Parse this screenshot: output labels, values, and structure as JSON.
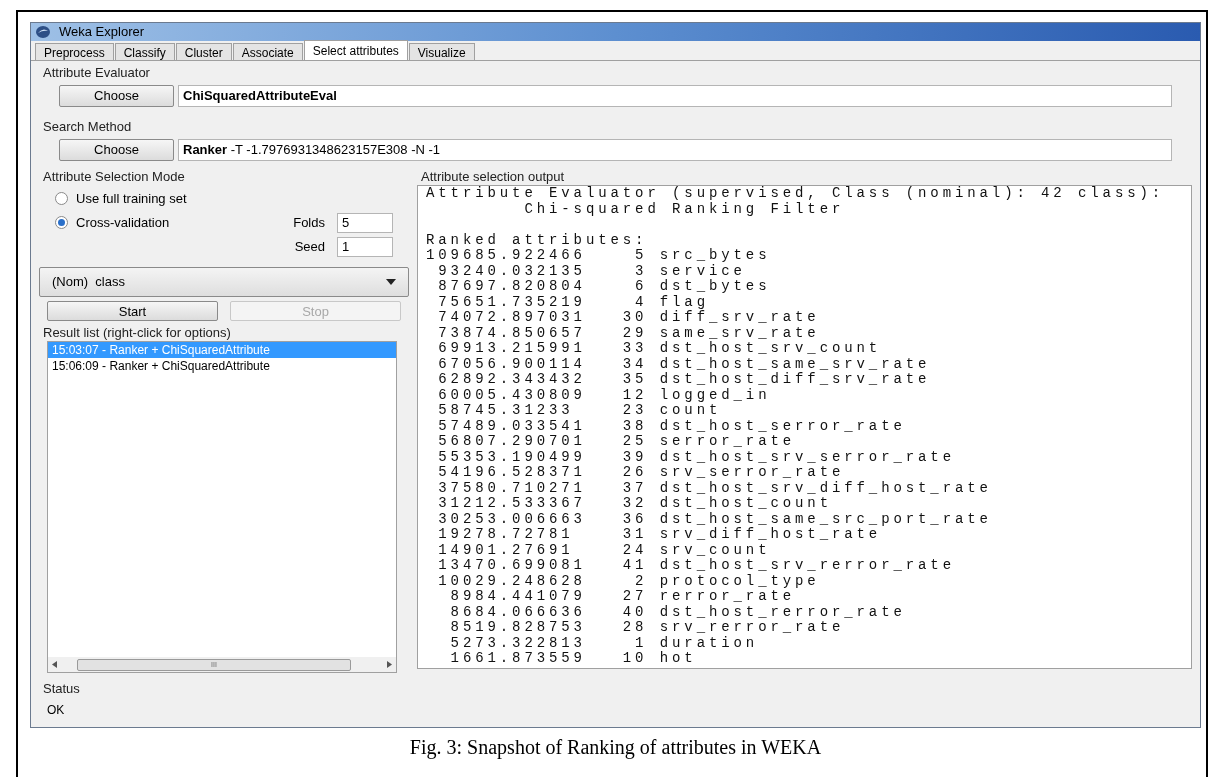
{
  "window": {
    "title": "Weka Explorer"
  },
  "tabs": [
    {
      "label": "Preprocess",
      "selected": false
    },
    {
      "label": "Classify",
      "selected": false
    },
    {
      "label": "Cluster",
      "selected": false
    },
    {
      "label": "Associate",
      "selected": false
    },
    {
      "label": "Select attributes",
      "selected": true
    },
    {
      "label": "Visualize",
      "selected": false
    }
  ],
  "attribute_evaluator": {
    "title": "Attribute Evaluator",
    "button": "Choose",
    "value": "ChiSquaredAttributeEval"
  },
  "search_method": {
    "title": "Search Method",
    "button": "Choose",
    "value": "**Ranker** -T -1.7976931348623157E308 -N -1"
  },
  "selection_mode": {
    "title": "Attribute Selection Mode",
    "options": [
      {
        "label": "Use full training set",
        "selected": false
      },
      {
        "label": "Cross-validation",
        "selected": true
      }
    ],
    "folds": {
      "label": "Folds",
      "value": "5"
    },
    "seed": {
      "label": "Seed",
      "value": "1"
    }
  },
  "class_dropdown": {
    "value": "(Nom)  class"
  },
  "buttons": [
    {
      "label": "Start",
      "disabled": false
    },
    {
      "label": "Stop",
      "disabled": true
    }
  ],
  "result_list": {
    "title": "Result list (right-click for options)",
    "items": [
      {
        "label": "15:03:07 - Ranker + ChiSquaredAttribute",
        "selected": true
      },
      {
        "label": "15:06:09 - Ranker + ChiSquaredAttribute",
        "selected": false
      }
    ],
    "scroll_thumb": "III"
  },
  "output": {
    "title": "Attribute selection output",
    "header": [
      "Attribute Evaluator (supervised, Class (nominal): 42 class):",
      "        Chi-squared Ranking Filter"
    ],
    "lines": [
      "Ranked attributes:",
      "109685.922466    5 src_bytes",
      " 93240.032135    3 service",
      " 87697.820804    6 dst_bytes",
      " 75651.735219    4 flag",
      " 74072.897031   30 diff_srv_rate",
      " 73874.850657   29 same_srv_rate",
      " 69913.215991   33 dst_host_srv_count",
      " 67056.900114   34 dst_host_same_srv_rate",
      " 62892.343432   35 dst_host_diff_srv_rate",
      " 60005.430809   12 logged_in",
      " 58745.31233    23 count",
      " 57489.033541   38 dst_host_serror_rate",
      " 56807.290701   25 serror_rate",
      " 55353.190499   39 dst_host_srv_serror_rate",
      " 54196.528371   26 srv_serror_rate",
      " 37580.710271   37 dst_host_srv_diff_host_rate",
      " 31212.533367   32 dst_host_count",
      " 30253.006663   36 dst_host_same_src_port_rate",
      " 19278.72781    31 srv_diff_host_rate",
      " 14901.27691    24 srv_count",
      " 13470.699081   41 dst_host_srv_rerror_rate",
      " 10029.248628    2 protocol_type",
      "  8984.441079   27 rerror_rate",
      "  8684.066636   40 dst_host_rerror_rate",
      "  8519.828753   28 srv_rerror_rate",
      "  5273.322813    1 duration",
      "  1661.873559   10 hot"
    ]
  },
  "status": {
    "title": "Status",
    "value": "OK"
  },
  "caption": "Fig. 3: Snapshot of Ranking of attributes in WEKA"
}
